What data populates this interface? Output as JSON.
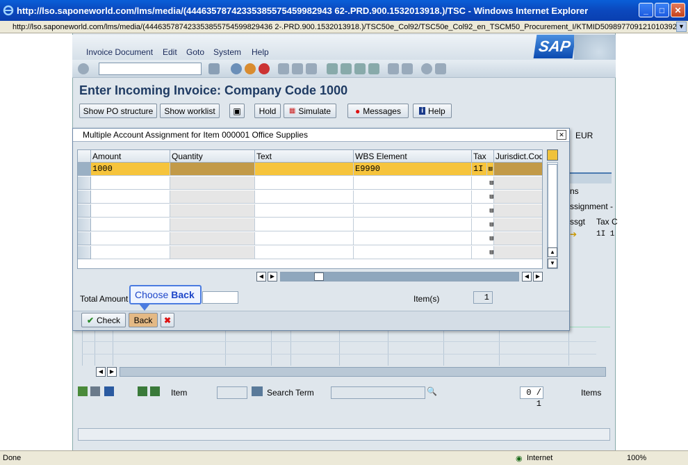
{
  "window": {
    "title": "http://lso.saponeworld.com/lms/media/(44463578742335385575459982943 62-.PRD.900.1532013918.)/TSC - Windows Internet Explorer",
    "address": "http://lso.saponeworld.com/lms/media/(444635787423353855754599829436 2-.PRD.900.1532013918.)/TSC50e_Col92/TSC50e_Col92_en_TSCM50_Procurement_I/KTMID509897709121010392 2"
  },
  "menu": [
    "Invoice Document",
    "Edit",
    "Goto",
    "System",
    "Help"
  ],
  "page_title": "Enter Incoming Invoice: Company Code 1000",
  "appbar": {
    "show_po": "Show PO structure",
    "show_worklist": "Show worklist",
    "hold": "Hold",
    "simulate": "Simulate",
    "messages": "Messages",
    "help": "Help"
  },
  "background": {
    "currency": "EUR",
    "tab_frag1": "ns",
    "tab_frag2": "ssignment -",
    "col_assgt": "ssgt",
    "col_tax": "Tax C",
    "tax_val": "1I 1",
    "item_label": "Item",
    "search_term": "Search Term",
    "page_counter": "0 / 1",
    "items_label": "Items"
  },
  "popup": {
    "title": "Multiple Account Assignment for Item 000001 Office Supplies",
    "columns": [
      "Amount",
      "Quantity",
      "Text",
      "WBS Element",
      "Tax",
      "Jurisdict.Code"
    ],
    "rows": [
      {
        "amount": "1000",
        "quantity": "",
        "text": "",
        "wbs": "E9990",
        "tax": "1I"
      }
    ],
    "total_amount_label": "Total Amount",
    "items_label": "Item(s)",
    "items_value": "1",
    "check_label": "Check",
    "back_label": "Back"
  },
  "tooltip": {
    "prefix": "Choose",
    "target": "Back"
  },
  "status": {
    "left": "Done",
    "zone": "Internet",
    "zoom": "100%"
  }
}
